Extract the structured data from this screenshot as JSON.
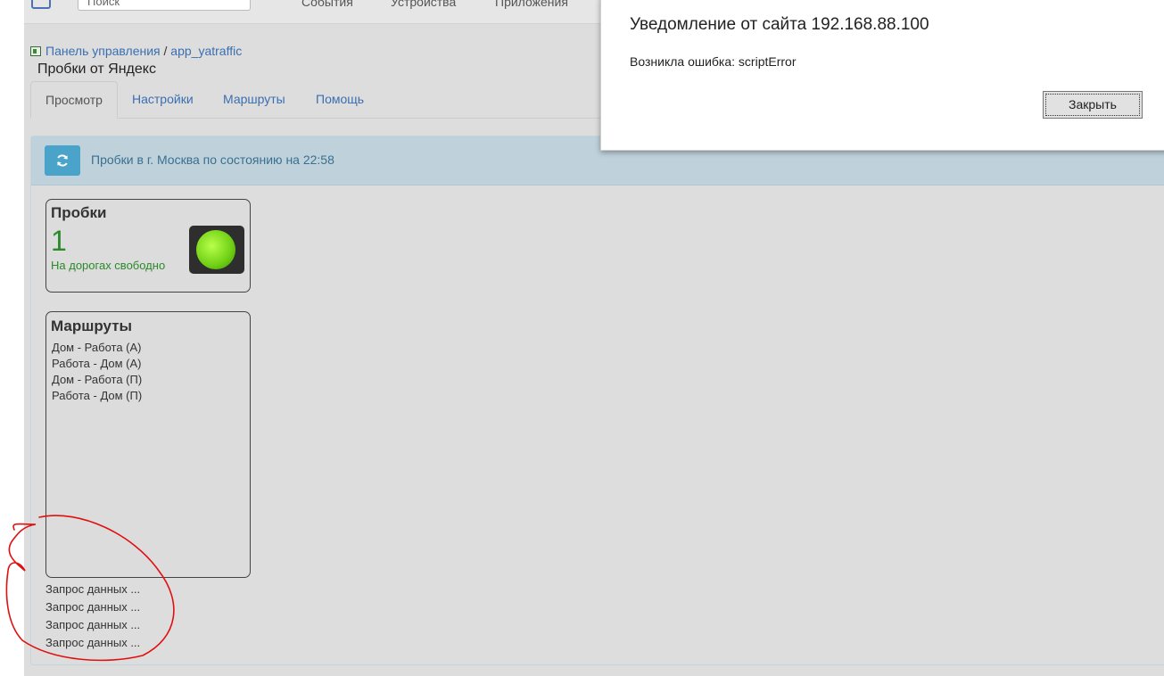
{
  "topnav": {
    "search_placeholder": "Поиск",
    "links": [
      "События",
      "Устройства",
      "Приложения"
    ]
  },
  "breadcrumb": {
    "items": [
      "Панель управления",
      "app_yatraffic"
    ],
    "separator": "/"
  },
  "page": {
    "title": "Пробки от Яндекс"
  },
  "tabs": [
    {
      "label": "Просмотр",
      "active": true
    },
    {
      "label": "Настройки",
      "active": false
    },
    {
      "label": "Маршруты",
      "active": false
    },
    {
      "label": "Помощь",
      "active": false
    }
  ],
  "panel": {
    "refresh_icon": "refresh-icon",
    "status_text": "Пробки в г. Москва по состоянию на 22:58"
  },
  "traffic": {
    "title": "Пробки",
    "score": "1",
    "hint": "На дорогах свободно",
    "light_icon": "traffic-light-green-icon",
    "color": "#2a8a2a"
  },
  "routes": {
    "title": "Маршруты",
    "items": [
      "Дом - Работа (А)",
      "Работа - Дом (А)",
      "Дом - Работа (П)",
      "Работа - Дом (П)"
    ]
  },
  "requests": [
    "Запрос данных ...",
    "Запрос данных ...",
    "Запрос данных ...",
    "Запрос данных ..."
  ],
  "dialog": {
    "title": "Уведомление от сайта 192.168.88.100",
    "message_prefix": "Возникла ошибка: ",
    "message_error": "scriptError",
    "close_label": "Закрыть"
  },
  "annotation_color": "#e01010"
}
